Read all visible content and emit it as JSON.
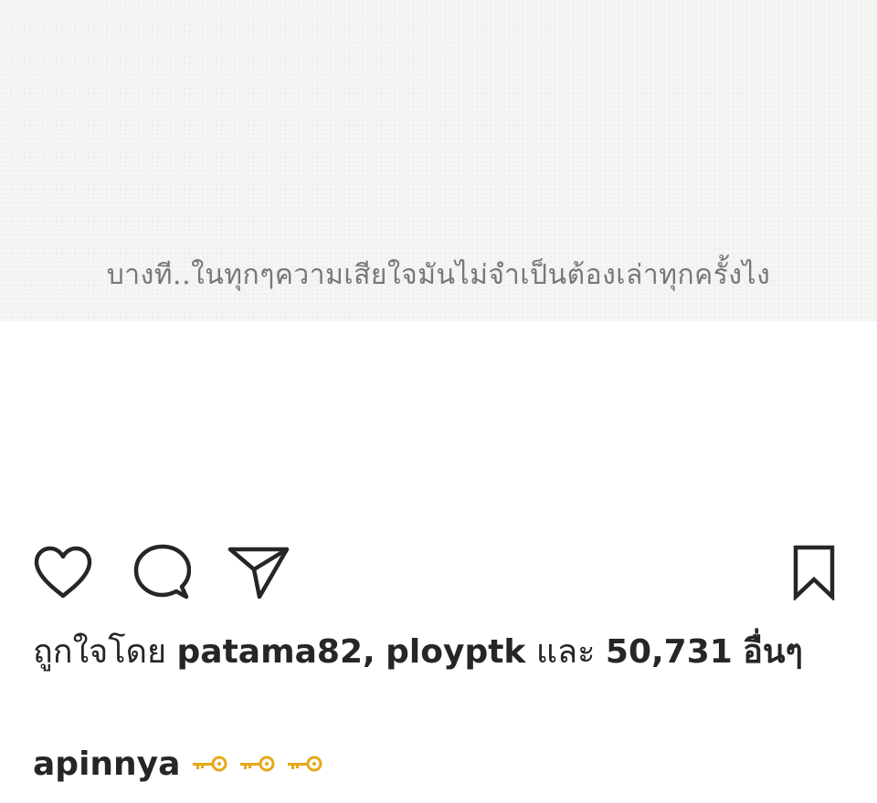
{
  "post": {
    "image_text": "บางที..ในทุกๆความเสียใจมันไม่จำเป็นต้องเล่าทุกครั้งไง"
  },
  "actions": {
    "like_icon": "heart-outline-icon",
    "comment_icon": "speech-bubble-icon",
    "share_icon": "paper-plane-icon",
    "save_icon": "bookmark-outline-icon"
  },
  "likes": {
    "prefix": "ถูกใจโดย",
    "user1": "patama82",
    "separator": ",",
    "user2": "ploypt­k",
    "conjunction": "และ",
    "count": "50,731",
    "suffix": "อื่นๆ"
  },
  "caption": {
    "username": "apinnya",
    "emoji": "key-emoji",
    "emoji_count": 3
  },
  "colors": {
    "text": "#262626",
    "image_text": "#777777",
    "key_gold": "#e6a817"
  }
}
